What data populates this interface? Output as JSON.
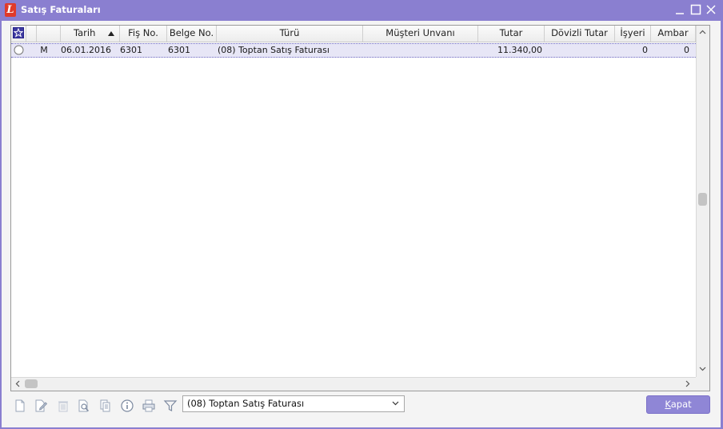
{
  "window": {
    "title": "Satış Faturaları",
    "logo_letter": "L"
  },
  "grid": {
    "columns": [
      {
        "key": "check",
        "label": ""
      },
      {
        "key": "flag",
        "label": ""
      },
      {
        "key": "tarih",
        "label": "Tarih",
        "sort": "ascending"
      },
      {
        "key": "fis_no",
        "label": "Fiş No."
      },
      {
        "key": "belge_no",
        "label": "Belge No."
      },
      {
        "key": "turu",
        "label": "Türü"
      },
      {
        "key": "musteri",
        "label": "Müşteri Unvanı"
      },
      {
        "key": "tutar",
        "label": "Tutar"
      },
      {
        "key": "dovizli",
        "label": "Dövizli Tutar"
      },
      {
        "key": "isyeri",
        "label": "İşyeri"
      },
      {
        "key": "ambar",
        "label": "Ambar"
      }
    ],
    "rows": [
      {
        "flag": "M",
        "tarih": "06.01.2016",
        "fis_no": "6301",
        "belge_no": "6301",
        "turu": "(08) Toptan Satış Faturası",
        "musteri": "",
        "tutar": "11.340,00",
        "dovizli": "",
        "isyeri": "0",
        "ambar": "0"
      }
    ]
  },
  "bottom": {
    "filter_value": "(08) Toptan Satış Faturası",
    "close_label_underlined": "K",
    "close_label_rest": "apat"
  },
  "colors": {
    "accent": "#8a7fd0",
    "selected_row": "#e7e6f6",
    "close_button": "#8f86d6"
  },
  "icons": [
    "new-document-icon",
    "edit-document-icon",
    "delete-icon",
    "preview-icon",
    "copy-document-icon",
    "info-icon",
    "print-icon",
    "filter-icon"
  ]
}
